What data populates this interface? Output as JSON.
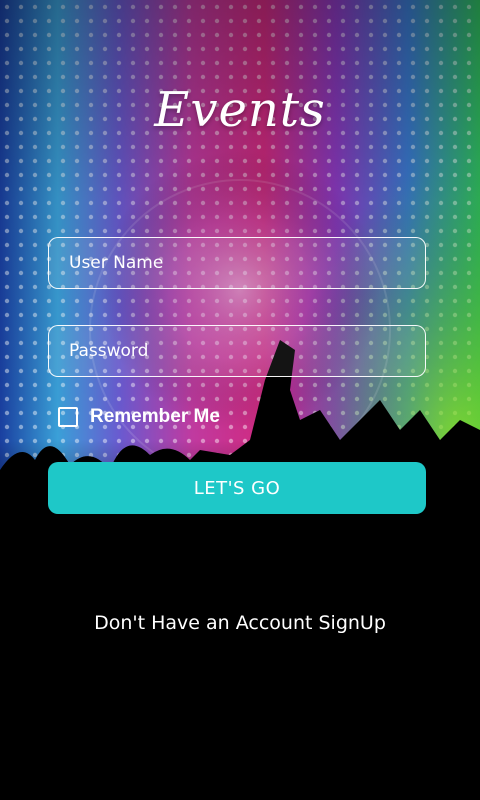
{
  "logo": {
    "text": "Events"
  },
  "login": {
    "username_placeholder": "User Name",
    "password_placeholder": "Password",
    "remember_label": "Remember Me",
    "remember_checked": false,
    "submit_label": "LET'S GO"
  },
  "footer": {
    "signup_text": "Don't Have an Account SignUp"
  },
  "colors": {
    "accent": "#1ec8c8",
    "text": "#ffffff",
    "background": "#000000"
  }
}
